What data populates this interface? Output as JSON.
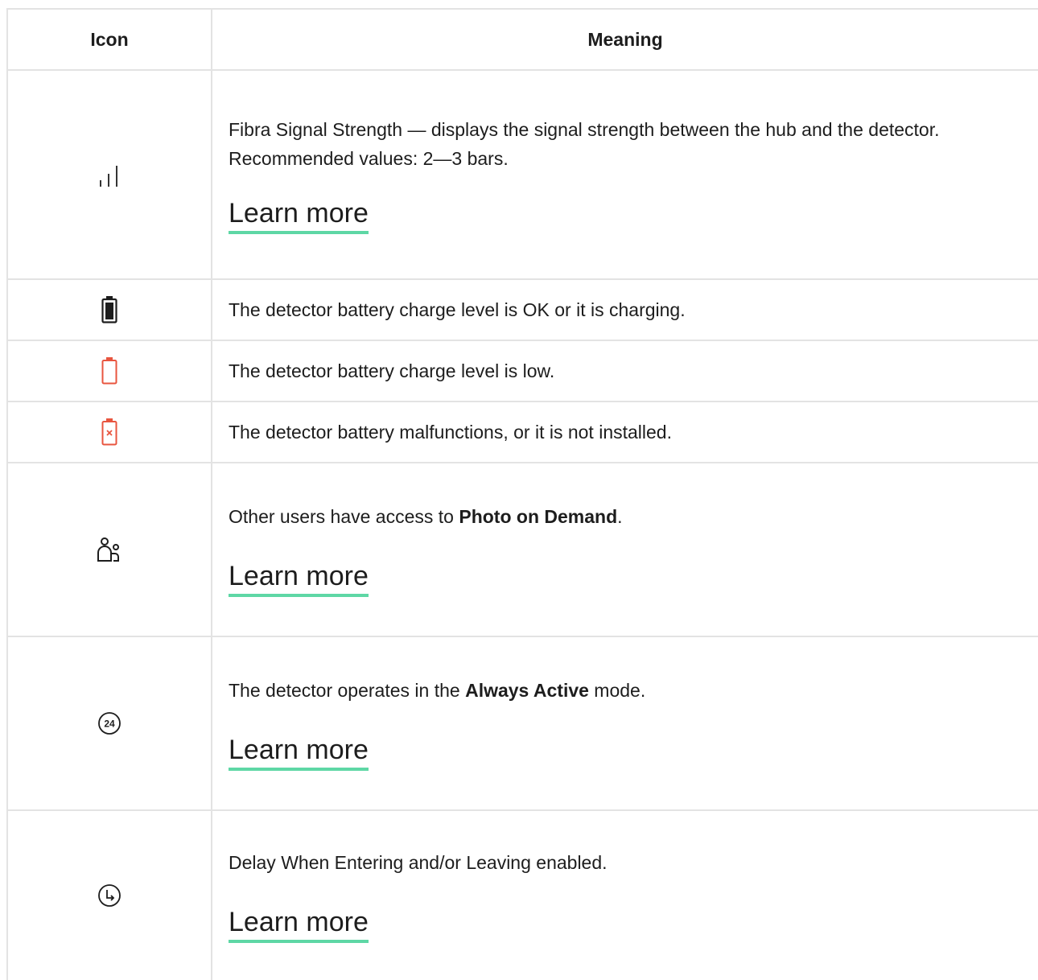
{
  "header": {
    "icon_col": "Icon",
    "meaning_col": "Meaning"
  },
  "rows": [
    {
      "icon": "signal-strength-icon",
      "text": "Fibra Signal Strength — displays the signal strength between the hub and the detector. Recommended values: 2—3 bars.",
      "link": "Learn more"
    },
    {
      "icon": "battery-ok-icon",
      "text": "The detector battery charge level is OK or it is charging."
    },
    {
      "icon": "battery-low-icon",
      "text": "The detector battery charge level is low."
    },
    {
      "icon": "battery-error-icon",
      "text": "The detector battery malfunctions, or it is not installed."
    },
    {
      "icon": "users-access-icon",
      "text_before": "Other users have access to ",
      "text_bold": "Photo on Demand",
      "text_after": ".",
      "link": "Learn more"
    },
    {
      "icon": "always-active-24-icon",
      "icon_label": "24",
      "text_before": "The detector operates in the ",
      "text_bold": "Always Active",
      "text_after": " mode.",
      "link": "Learn more"
    },
    {
      "icon": "delay-clock-icon",
      "text": "Delay When Entering and/or Leaving enabled.",
      "link": "Learn more"
    }
  ],
  "colors": {
    "link_underline": "#5ed7a5",
    "battery_alert": "#e8553f",
    "border": "#e3e3e3"
  }
}
